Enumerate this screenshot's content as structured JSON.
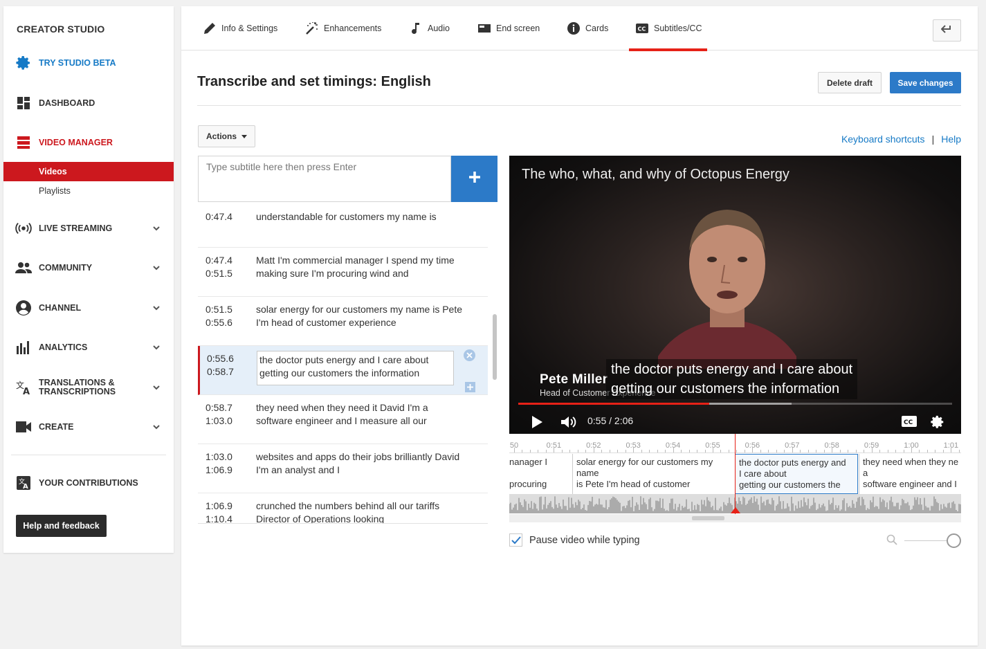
{
  "sidebar": {
    "brand": "CREATOR STUDIO",
    "try_beta": "TRY STUDIO BETA",
    "dashboard": "DASHBOARD",
    "video_manager": "VIDEO MANAGER",
    "videos": "Videos",
    "playlists": "Playlists",
    "live_streaming": "LIVE STREAMING",
    "community": "COMMUNITY",
    "channel": "CHANNEL",
    "analytics": "ANALYTICS",
    "translations_1": "TRANSLATIONS &",
    "translations_2": "TRANSCRIPTIONS",
    "create": "CREATE",
    "contributions": "YOUR CONTRIBUTIONS",
    "help_feedback": "Help and feedback"
  },
  "tabs": {
    "info": "Info & Settings",
    "enhancements": "Enhancements",
    "audio": "Audio",
    "end_screen": "End screen",
    "cards": "Cards",
    "subtitles": "Subtitles/CC"
  },
  "editor": {
    "title": "Transcribe and set timings: English",
    "delete_draft": "Delete draft",
    "save_changes": "Save changes",
    "actions": "Actions",
    "keyboard_shortcuts": "Keyboard shortcuts",
    "separator": "|",
    "help": "Help",
    "input_placeholder": "Type subtitle here then press Enter",
    "pause_label": "Pause video while typing"
  },
  "cues": [
    {
      "start": "0:47.4",
      "end": "",
      "text": "understandable for customers my name is"
    },
    {
      "start": "0:47.4",
      "end": "0:51.5",
      "text": "Matt I'm commercial manager I spend my time making sure I'm procuring wind and"
    },
    {
      "start": "0:51.5",
      "end": "0:55.6",
      "text": "solar energy for our customers my name is Pete I'm head of customer experience"
    },
    {
      "start": "0:55.6",
      "end": "0:58.7",
      "text": "the doctor puts energy and I care about getting our customers the information"
    },
    {
      "start": "0:58.7",
      "end": "1:03.0",
      "text": "they need when they need it David I'm a software engineer and I measure all our"
    },
    {
      "start": "1:03.0",
      "end": "1:06.9",
      "text": "websites and apps do their jobs brilliantly David I'm an analyst and I"
    },
    {
      "start": "1:06.9",
      "end": "1:10.4",
      "text": "crunched the numbers behind all our tariffs Director of Operations looking"
    }
  ],
  "video": {
    "title": "The who, what, and why of Octopus Energy",
    "name": "Pete Miller",
    "role": "Head of Customer Experience",
    "caption_1": "the doctor puts energy and I care about",
    "caption_2": "getting our customers the information",
    "time": "0:55 / 2:06",
    "progress": 0.44,
    "buffered": 0.63
  },
  "timeline": {
    "ticks": [
      "50",
      "0:51",
      "0:52",
      "0:53",
      "0:54",
      "0:55",
      "0:56",
      "0:57",
      "0:58",
      "0:59",
      "1:00",
      "1:01"
    ],
    "segments": [
      {
        "lines": [
          "nanager I",
          "",
          "procuring"
        ]
      },
      {
        "lines": [
          "solar energy for our customers my",
          "name",
          "is Pete I'm head of customer"
        ]
      },
      {
        "lines": [
          "the doctor puts energy and",
          "I care about",
          "getting our customers the"
        ]
      },
      {
        "lines": [
          "they need when they ne",
          "a",
          "software engineer and I"
        ]
      }
    ]
  },
  "colors": {
    "red": "#cc181e",
    "blue": "#2c7ac8",
    "link_blue": "#167ac6"
  }
}
